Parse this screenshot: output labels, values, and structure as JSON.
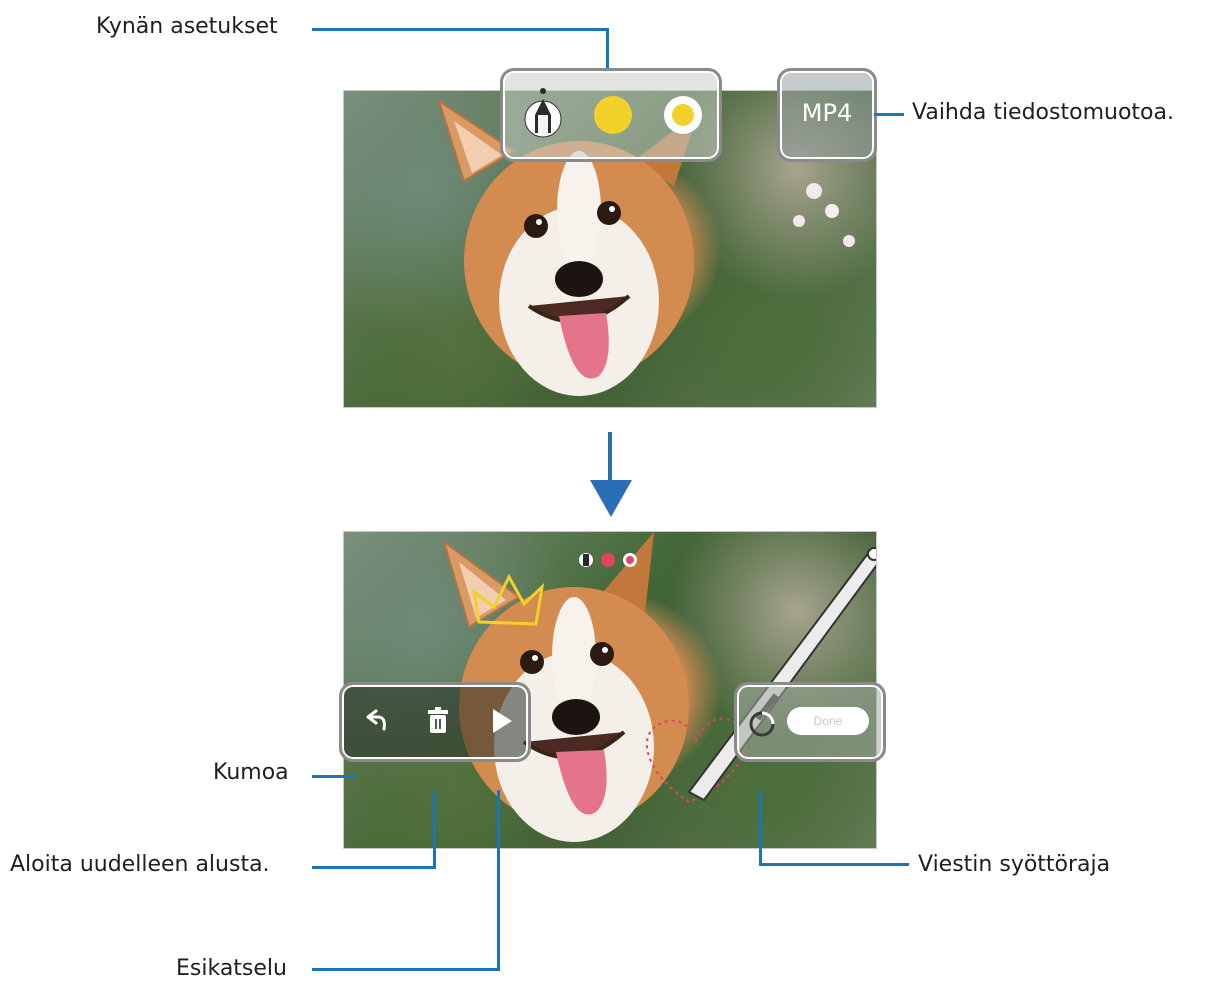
{
  "labels": {
    "pen_settings": "Kynän asetukset",
    "change_format": "Vaihda tiedostomuotoa.",
    "undo": "Kumoa",
    "restart": "Aloita uudelleen alusta.",
    "preview": "Esikatselu",
    "input_limit": "Viestin syöttöraja"
  },
  "top_panel": {
    "format_button": "MP4",
    "pen_icon": "pen-tip-icon",
    "color_icon": "color-circle-icon",
    "size_icon": "pen-size-icon",
    "pen_color": "#f2d12b"
  },
  "bottom_panel": {
    "undo_icon": "undo-arrow-icon",
    "trash_icon": "trash-icon",
    "play_icon": "play-icon",
    "done_label": "Done",
    "pen_color": "#e0455f"
  },
  "colors": {
    "callout_line": "#1a76b8",
    "arrow": "#2a6fb5"
  }
}
